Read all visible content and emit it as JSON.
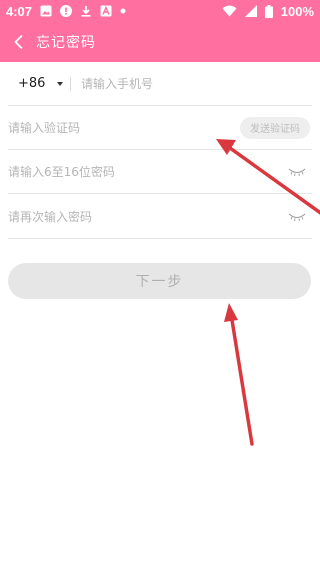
{
  "status_bar": {
    "time": "4:07",
    "battery": "100%",
    "icons": [
      "image-icon",
      "alert-icon",
      "download-icon",
      "font-icon",
      "dot-icon"
    ],
    "right_icons": [
      "wifi-icon",
      "signal-icon",
      "battery-icon"
    ]
  },
  "header": {
    "title": "忘记密码",
    "back_icon": "chevron-left-icon",
    "background": "#ff6f9f"
  },
  "form": {
    "country_code": "+86",
    "phone_placeholder": "请输入手机号",
    "code_placeholder": "请输入验证码",
    "send_code_label": "发送验证码",
    "password_placeholder": "请输入6至16位密码",
    "password_confirm_placeholder": "请再次输入密码",
    "next_label": "下一步"
  },
  "annotations": {
    "arrow_color": "#d9383f"
  }
}
